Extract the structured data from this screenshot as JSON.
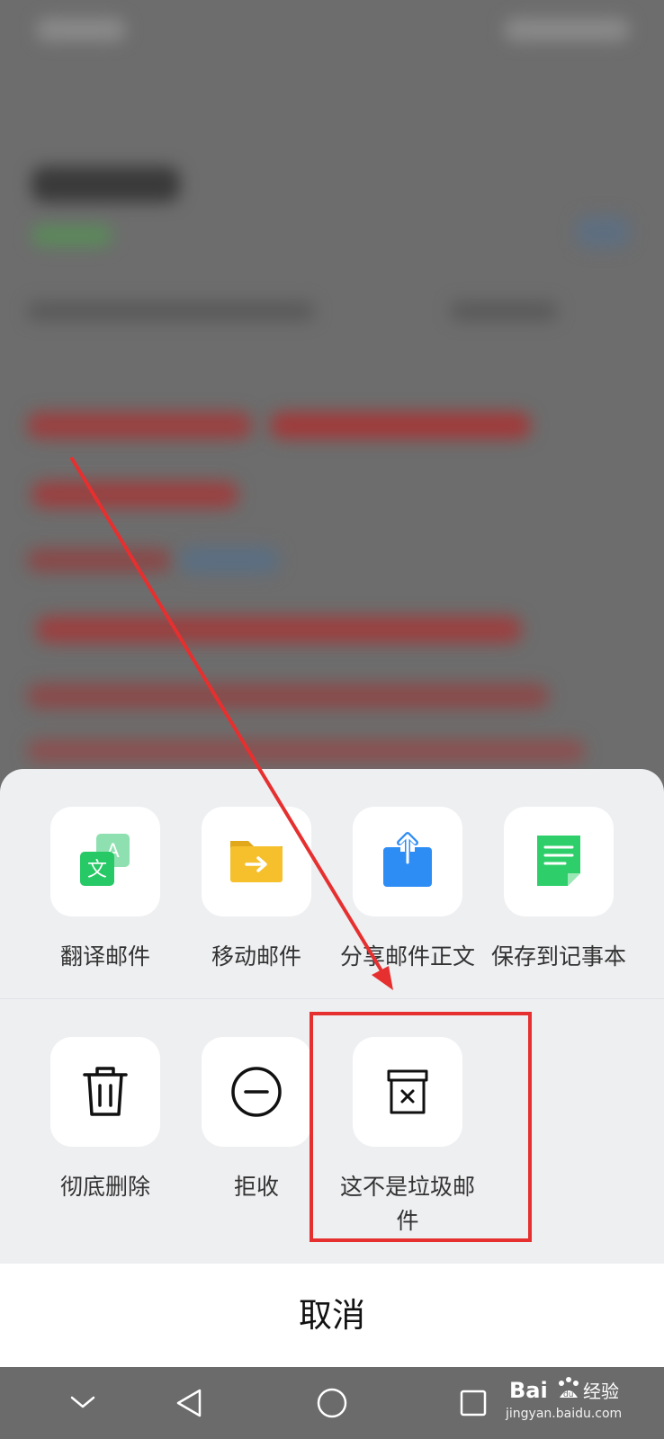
{
  "actions_row1": [
    {
      "label": "翻译邮件",
      "icon": "translate-icon"
    },
    {
      "label": "移动邮件",
      "icon": "folder-move-icon"
    },
    {
      "label": "分享邮件正文",
      "icon": "share-icon"
    },
    {
      "label": "保存到记事本",
      "icon": "notepad-icon"
    }
  ],
  "actions_row2": [
    {
      "label": "彻底删除",
      "icon": "trash-icon"
    },
    {
      "label": "拒收",
      "icon": "block-icon"
    },
    {
      "label": "这不是垃圾邮件",
      "icon": "not-spam-icon"
    }
  ],
  "cancel_label": "取消",
  "watermark": {
    "brand": "Baidu经验",
    "url": "jingyan.baidu.com"
  },
  "colors": {
    "translate": "#2ecc71",
    "folder": "#f5c02c",
    "share": "#2e8cf5",
    "notepad": "#2ecf6a",
    "annotation": "#e63030"
  }
}
